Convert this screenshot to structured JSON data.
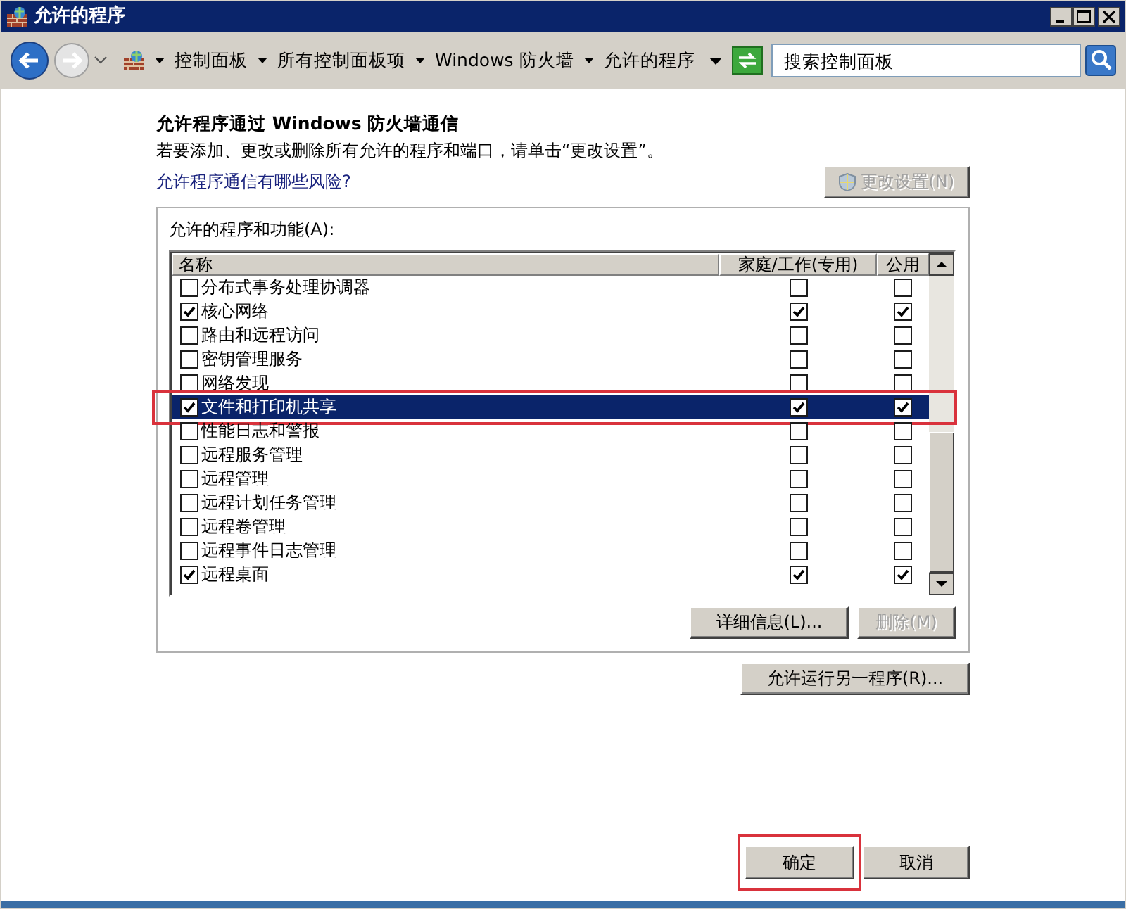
{
  "window": {
    "title": "允许的程序"
  },
  "address_bar": {
    "breadcrumbs": [
      "控制面板",
      "所有控制面板项",
      "Windows 防火墙",
      "允许的程序"
    ]
  },
  "search": {
    "placeholder": "搜索控制面板"
  },
  "heading": "允许程序通过 Windows 防火墙通信",
  "description": "若要添加、更改或删除所有允许的程序和端口，请单击“更改设置”。",
  "risk_link": "允许程序通信有哪些风险?",
  "change_settings_button": {
    "label": "更改设置(N)",
    "disabled": true
  },
  "group": {
    "label": "允许的程序和功能(A):",
    "columns": [
      "名称",
      "家庭/工作(专用)",
      "公用"
    ],
    "rows": [
      {
        "name": "分布式事务处理协调器",
        "checked": false,
        "home": false,
        "public": false,
        "selected": false,
        "highlighted": false
      },
      {
        "name": "核心网络",
        "checked": true,
        "home": true,
        "public": true,
        "selected": false,
        "highlighted": false
      },
      {
        "name": "路由和远程访问",
        "checked": false,
        "home": false,
        "public": false,
        "selected": false,
        "highlighted": false
      },
      {
        "name": "密钥管理服务",
        "checked": false,
        "home": false,
        "public": false,
        "selected": false,
        "highlighted": false
      },
      {
        "name": "网络发现",
        "checked": false,
        "home": false,
        "public": false,
        "selected": false,
        "highlighted": false
      },
      {
        "name": "文件和打印机共享",
        "checked": true,
        "home": true,
        "public": true,
        "selected": true,
        "highlighted": true
      },
      {
        "name": "性能日志和警报",
        "checked": false,
        "home": false,
        "public": false,
        "selected": false,
        "highlighted": false
      },
      {
        "name": "远程服务管理",
        "checked": false,
        "home": false,
        "public": false,
        "selected": false,
        "highlighted": false
      },
      {
        "name": "远程管理",
        "checked": false,
        "home": false,
        "public": false,
        "selected": false,
        "highlighted": false
      },
      {
        "name": "远程计划任务管理",
        "checked": false,
        "home": false,
        "public": false,
        "selected": false,
        "highlighted": false
      },
      {
        "name": "远程卷管理",
        "checked": false,
        "home": false,
        "public": false,
        "selected": false,
        "highlighted": false
      },
      {
        "name": "远程事件日志管理",
        "checked": false,
        "home": false,
        "public": false,
        "selected": false,
        "highlighted": false
      },
      {
        "name": "远程桌面",
        "checked": true,
        "home": true,
        "public": true,
        "selected": false,
        "highlighted": false
      }
    ]
  },
  "details_button": {
    "label": "详细信息(L)...",
    "disabled": false
  },
  "remove_button": {
    "label": "删除(M)",
    "disabled": true
  },
  "add_program_button": {
    "label": "允许运行另一程序(R)...",
    "disabled": false
  },
  "buttons": [
    {
      "label": "确定",
      "highlighted": true
    },
    {
      "label": "取消",
      "highlighted": false
    }
  ]
}
